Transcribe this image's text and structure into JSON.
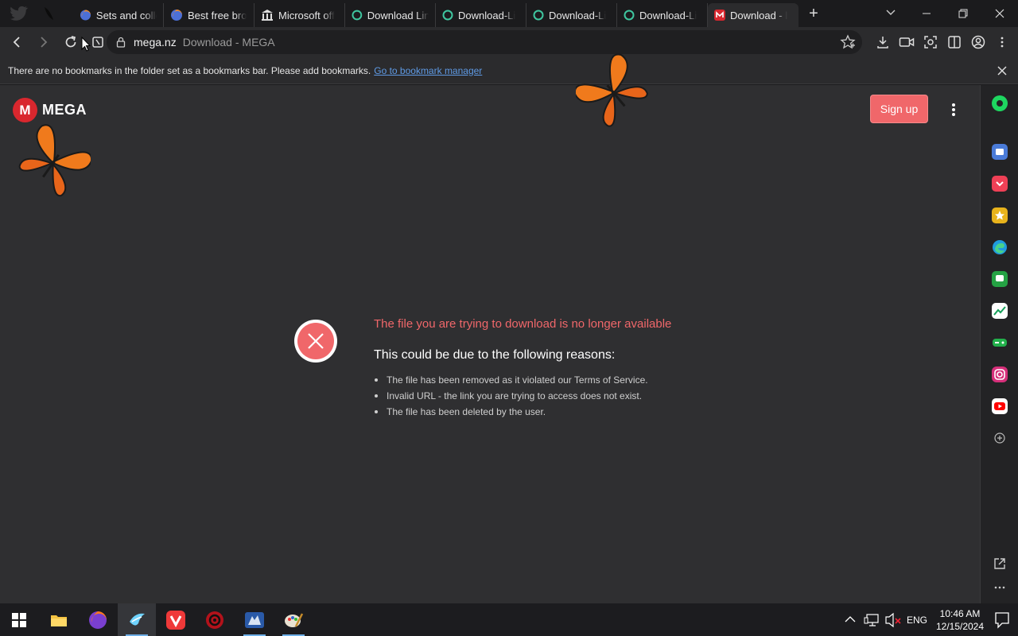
{
  "browser": {
    "tabs": [
      {
        "label": "Sets and colle",
        "icon": "firefox-icon"
      },
      {
        "label": "Best free bro",
        "icon": "firefox-icon"
      },
      {
        "label": "Microsoft off",
        "icon": "bank-icon"
      },
      {
        "label": "Download Lin",
        "icon": "circle-icon"
      },
      {
        "label": "Download-Li",
        "icon": "circle-icon"
      },
      {
        "label": "Download-Li",
        "icon": "circle-icon"
      },
      {
        "label": "Download-Li",
        "icon": "circle-icon"
      },
      {
        "label": "Download - l",
        "icon": "mega-icon",
        "active": true
      }
    ],
    "new_tab_label": "+",
    "address": {
      "domain": "mega.nz",
      "title": "Download - MEGA"
    },
    "bookmarks_bar": {
      "message": "There are no bookmarks in the folder set as a bookmarks bar. Please add bookmarks.",
      "link": "Go to bookmark manager"
    }
  },
  "page": {
    "logo_letter": "M",
    "logo_text": "MEGA",
    "signup_label": "Sign up",
    "error_title": "The file you are trying to download is no longer available",
    "error_subtitle": "This could be due to the following reasons:",
    "reasons": [
      "The file has been removed as it violated our Terms of Service.",
      "Invalid URL - the link you are trying to access does not exist.",
      "The file has been deleted by the user."
    ]
  },
  "taskbar": {
    "language": "ENG",
    "time": "10:46 AM",
    "date": "12/15/2024"
  },
  "colors": {
    "accent_red": "#f0676a",
    "mega_red": "#d9272e",
    "link_blue": "#5f9be6"
  }
}
